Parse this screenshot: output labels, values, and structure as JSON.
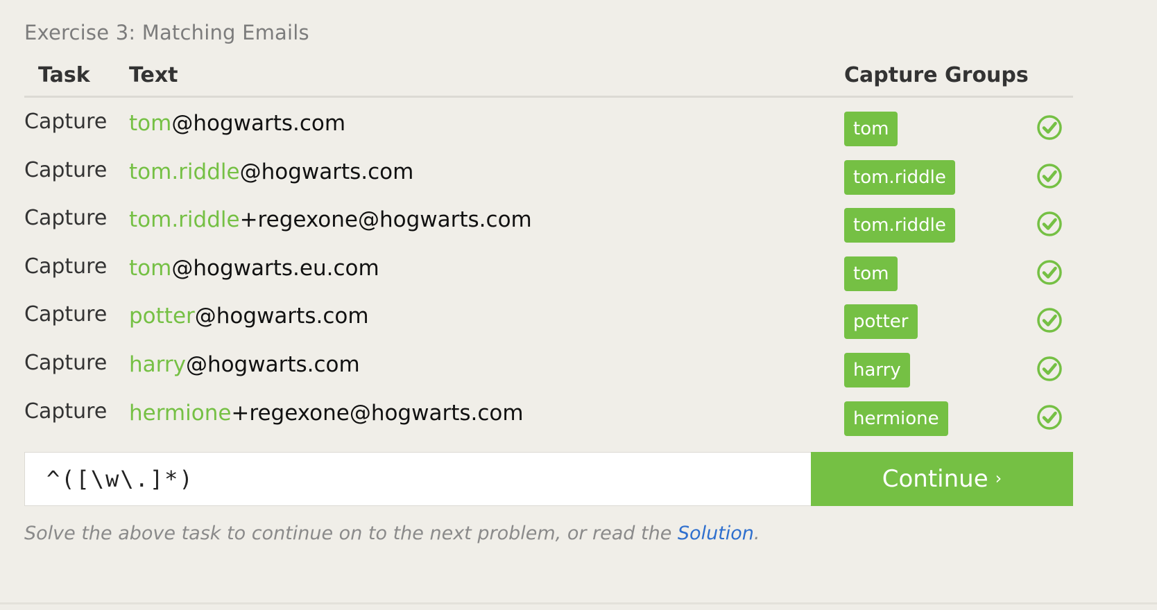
{
  "exercise": {
    "title": "Exercise 3: Matching Emails"
  },
  "table": {
    "headers": {
      "task": "Task",
      "text": "Text",
      "groups": "Capture Groups"
    },
    "rows": [
      {
        "task": "Capture",
        "match": "tom",
        "rest": "@hogwarts.com",
        "group": "tom",
        "status": "check-circle-icon"
      },
      {
        "task": "Capture",
        "match": "tom.riddle",
        "rest": "@hogwarts.com",
        "group": "tom.riddle",
        "status": "check-circle-icon"
      },
      {
        "task": "Capture",
        "match": "tom.riddle",
        "rest": "+regexone@hogwarts.com",
        "group": "tom.riddle",
        "status": "check-circle-icon"
      },
      {
        "task": "Capture",
        "match": "tom",
        "rest": "@hogwarts.eu.com",
        "group": "tom",
        "status": "check-circle-icon"
      },
      {
        "task": "Capture",
        "match": "potter",
        "rest": "@hogwarts.com",
        "group": "potter",
        "status": "check-circle-icon"
      },
      {
        "task": "Capture",
        "match": "harry",
        "rest": "@hogwarts.com",
        "group": "harry",
        "status": "check-circle-icon"
      },
      {
        "task": "Capture",
        "match": "hermione",
        "rest": "+regexone@hogwarts.com",
        "group": "hermione",
        "status": "check-circle-icon"
      }
    ]
  },
  "input": {
    "value": "^([\\w\\.]*)"
  },
  "continue_button": {
    "label": "Continue",
    "chevron": "›"
  },
  "footer": {
    "text": "Solve the above task to continue on to the next problem, or read the ",
    "link": "Solution",
    "end": "."
  },
  "colors": {
    "accent": "#75c044",
    "link": "#2e6fce",
    "background": "#f0eee8"
  }
}
